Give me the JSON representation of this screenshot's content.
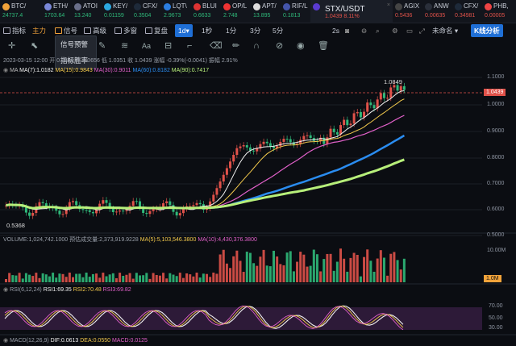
{
  "tickers": [
    {
      "name": "BTC/",
      "price": "24737.4",
      "color": "#f2a33a",
      "dir": "dn"
    },
    {
      "name": "ETH/",
      "price": "1703.64",
      "color": "#7a88d8",
      "dir": "dn"
    },
    {
      "name": "ATOI",
      "price": "13.240",
      "color": "#6a6f8a",
      "dir": "dn"
    },
    {
      "name": "KEY/",
      "price": "0.01159",
      "color": "#2ca8e0",
      "dir": "dn"
    },
    {
      "name": "CFX/",
      "price": "0.3504",
      "color": "#1e2a3a",
      "dir": "dn"
    },
    {
      "name": "LQT\\",
      "price": "2.9673",
      "color": "#2b7de0",
      "dir": "dn"
    },
    {
      "name": "BLUI",
      "price": "0.6633",
      "color": "#d33",
      "dir": "dn"
    },
    {
      "name": "OP/L",
      "price": "2.748",
      "color": "#e33",
      "dir": "dn"
    },
    {
      "name": "APT/",
      "price": "13.895",
      "color": "#ddd",
      "dir": "dn"
    },
    {
      "name": "RIF/L",
      "price": "0.1813",
      "color": "#4455aa",
      "dir": "dn"
    },
    {
      "name": "STX/USDT",
      "price": "1.0439",
      "change": "8.11%",
      "color": "#5a3bd0",
      "dir": "up",
      "active": true
    },
    {
      "name": "AGIX",
      "price": "0.5436",
      "color": "#444",
      "dir": "up"
    },
    {
      "name": "ANW",
      "price": "0.00635",
      "color": "#2a2f3a",
      "dir": "up"
    },
    {
      "name": "CFX/",
      "price": "0.34981",
      "color": "#1e2a3a",
      "dir": "up"
    },
    {
      "name": "PHB,",
      "price": "0.00005",
      "color": "#e44",
      "dir": "up"
    }
  ],
  "toolbar": {
    "indicator": "指标",
    "main": "主力",
    "signal": "信号",
    "advanced": "高级",
    "multi": "多窗",
    "replay": "复盘",
    "interval_selected": "1d",
    "interval_dropdown": "▾",
    "intervals": [
      "1秒",
      "1分",
      "3分",
      "5分"
    ],
    "right_2s": "2s",
    "unsigned": "未命名",
    "kline": "K线分析"
  },
  "popup": {
    "items": [
      "信号预警",
      "指标胜率"
    ]
  },
  "info": {
    "line1": "2023-03-15 12:00  开 0.9656 高 1.0656 低 1.0351 收 1.0439  涨幅 -0.39%(-0.0041)  振幅 2.91%",
    "ma": [
      "MA",
      "MA(7):1.0182",
      "MA(15):0.9843",
      "MA(30):0.9011",
      "MA(60):0.8182",
      "MA(90):0.7417"
    ]
  },
  "chart_data": {
    "type": "candlestick",
    "price_axis": [
      "1.1000",
      "1.0000",
      "0.9000",
      "0.8000",
      "0.7000",
      "0.6000",
      "0.5000"
    ],
    "high_label": "1.0849",
    "low_label": "0.5368",
    "current_price": "1.0439",
    "volume_label": "VOLUME",
    "volume_value": "VOLUME:1,024,742.1000",
    "volume_forecast": "预估成交量:2,373,919.9228",
    "vol_ma5": "MA(5):5,103,546.3800",
    "vol_ma10": "MA(10):4,430,376.3800",
    "vol_axis": [
      "10.00M"
    ],
    "vol_current": "1.0M",
    "rsi": [
      "RSI(6,12,24)",
      "RSI1:69.35",
      "RSI2:70.48",
      "RSI3:69.82"
    ],
    "rsi_axis": [
      "70.00",
      "50.00",
      "30.00"
    ],
    "macd": [
      "MACD(12,26,9)",
      "DIF:0.0613",
      "DEA:0.0550",
      "MACD:0.0125"
    ],
    "colors": {
      "up": "#e0524a",
      "down": "#2fb97a",
      "ma7": "#f0f0f0",
      "ma15": "#f2c94c",
      "ma30": "#e060c8",
      "ma60": "#2a8cf0",
      "ma90": "#b7ef7a"
    }
  }
}
